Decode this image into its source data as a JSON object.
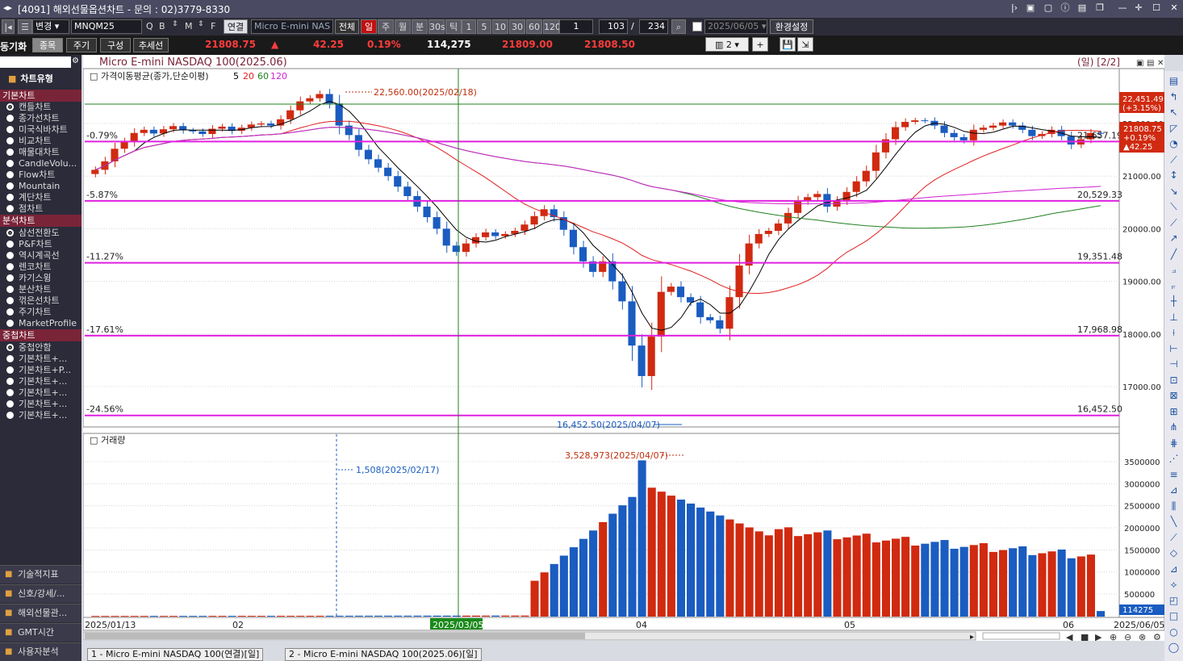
{
  "titlebar": {
    "title": "[4091] 해외선물옵션차트 - 문의 : 02)3779-8330"
  },
  "toolbar": {
    "change_label": "변경",
    "symbol_code": "MNQM25",
    "link_label": "연결",
    "symbol_name": "Micro E-mini NAS",
    "all_label": "전체",
    "periods": [
      "일",
      "주",
      "월",
      "분",
      "30s",
      "틱"
    ],
    "intervals": [
      "1",
      "5",
      "10",
      "30",
      "60",
      "120"
    ],
    "interval_value": "1",
    "page_current": "103",
    "page_separator": "/",
    "page_total": "234",
    "date_value": "2025/06/05",
    "settings_label": "환경설정",
    "layout_count": "2"
  },
  "quote": {
    "sync_label": "동기화",
    "item_label": "종목",
    "period_label": "주기",
    "compose_label": "구성",
    "trend_label": "추세선",
    "price": "21808.75",
    "change_arrow": "▲",
    "change": "42.25",
    "change_pct": "0.19%",
    "volume": "114,275",
    "ask": "21809.00",
    "bid": "21808.50"
  },
  "sidebar": {
    "chart_type_header": "차트유형",
    "basic_header": "기본차트",
    "basic_items": [
      "캔들차트",
      "종가선차트",
      "미국식바차트",
      "비교차트",
      "매물대차트",
      "CandleVolu...",
      "Flow차트",
      "Mountain",
      "계단차트",
      "점차트"
    ],
    "analysis_header": "분석차트",
    "analysis_items": [
      "삼선전환도",
      "P&F차트",
      "역시계곡선",
      "렌코차트",
      "카기스윙",
      "분산차트",
      "꺾은선차트",
      "주기차트",
      "MarketProfile"
    ],
    "overlay_header": "중첩차트",
    "overlay_items": [
      "중첩안함",
      "기본차트+...",
      "기본차트+P...",
      "기본차트+...",
      "기본차트+...",
      "기본차트+...",
      "기본차트+..."
    ],
    "bottom_items": [
      "기술적지표",
      "신호/강세/...",
      "해외선물관...",
      "GMT시간",
      "사용자분석"
    ]
  },
  "chart": {
    "title": "Micro E-mini NASDAQ 100(2025.06)",
    "period_label": "(일) [2/2]",
    "ma_label": "가격이동평균(종가,단순이평)",
    "ma_periods": [
      "5",
      "20",
      "60",
      "120"
    ],
    "ma_colors": [
      "#000000",
      "#e02020",
      "#208020",
      "#d020d0"
    ],
    "volume_label": "거래량",
    "price_high_annotation": "22,560.00(2025/02/18)",
    "price_low_annotation": "16,452.50(2025/04/07)",
    "volume_high_annotation": "3,528,973(2025/04/07)",
    "volume_low_annotation": "1,508(2025/02/17)",
    "current_price_box": [
      "21808.75",
      "+0.19%",
      "▲42.25"
    ],
    "high_box": [
      "22,451.49",
      "(+3.15%)"
    ],
    "current_volume_box": "114275",
    "date_start": "2025/01/13",
    "date_end": "2025/06/05",
    "date_cursor": "2025/03/05",
    "month_labels": [
      "02",
      "04",
      "05",
      "06"
    ],
    "price_axis_ticks": [
      "22,000.00",
      "21000.00",
      "20000.00",
      "19000.00",
      "18000.00",
      "17000.00"
    ],
    "volume_axis_ticks": [
      "3500000",
      "3000000",
      "2500000",
      "2000000",
      "1500000",
      "1000000",
      "500000"
    ],
    "levels": [
      {
        "pct": "-0.79%",
        "price": "21,657.19"
      },
      {
        "pct": "-5.87%",
        "price": "20,529.33"
      },
      {
        "pct": "-11.27%",
        "price": "19,351.48"
      },
      {
        "pct": "-17.61%",
        "price": "17,968.98"
      },
      {
        "pct": "-24.56%",
        "price": "16,452.50"
      }
    ]
  },
  "bottom_tabs": [
    "1 - Micro E-mini NASDAQ 100(연결)[일]",
    "2 - Micro E-mini NASDAQ 100(2025.06)[일]"
  ]
}
